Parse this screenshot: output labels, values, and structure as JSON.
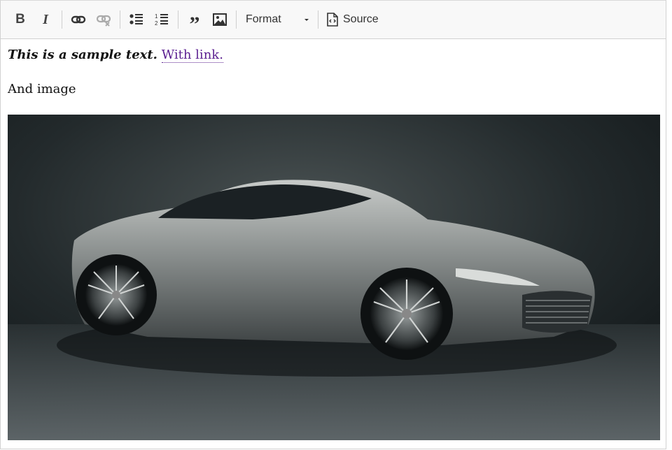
{
  "toolbar": {
    "buttons": {
      "bold": "B",
      "italic": "I",
      "link": "link-icon",
      "unlink": "unlink-icon",
      "bulleted_list": "bulleted-list-icon",
      "numbered_list": "numbered-list-icon",
      "blockquote": "”",
      "image": "image-icon"
    },
    "format_label": "Format",
    "source_label": "Source"
  },
  "content": {
    "bold_italic_text": "This is a sample text.",
    "link_text": "With link.",
    "paragraph_2": "And image",
    "image": "car-image"
  },
  "colors": {
    "link": "#5a1e90",
    "toolbar_bg": "#f8f8f8",
    "border": "#d1d1d1"
  }
}
